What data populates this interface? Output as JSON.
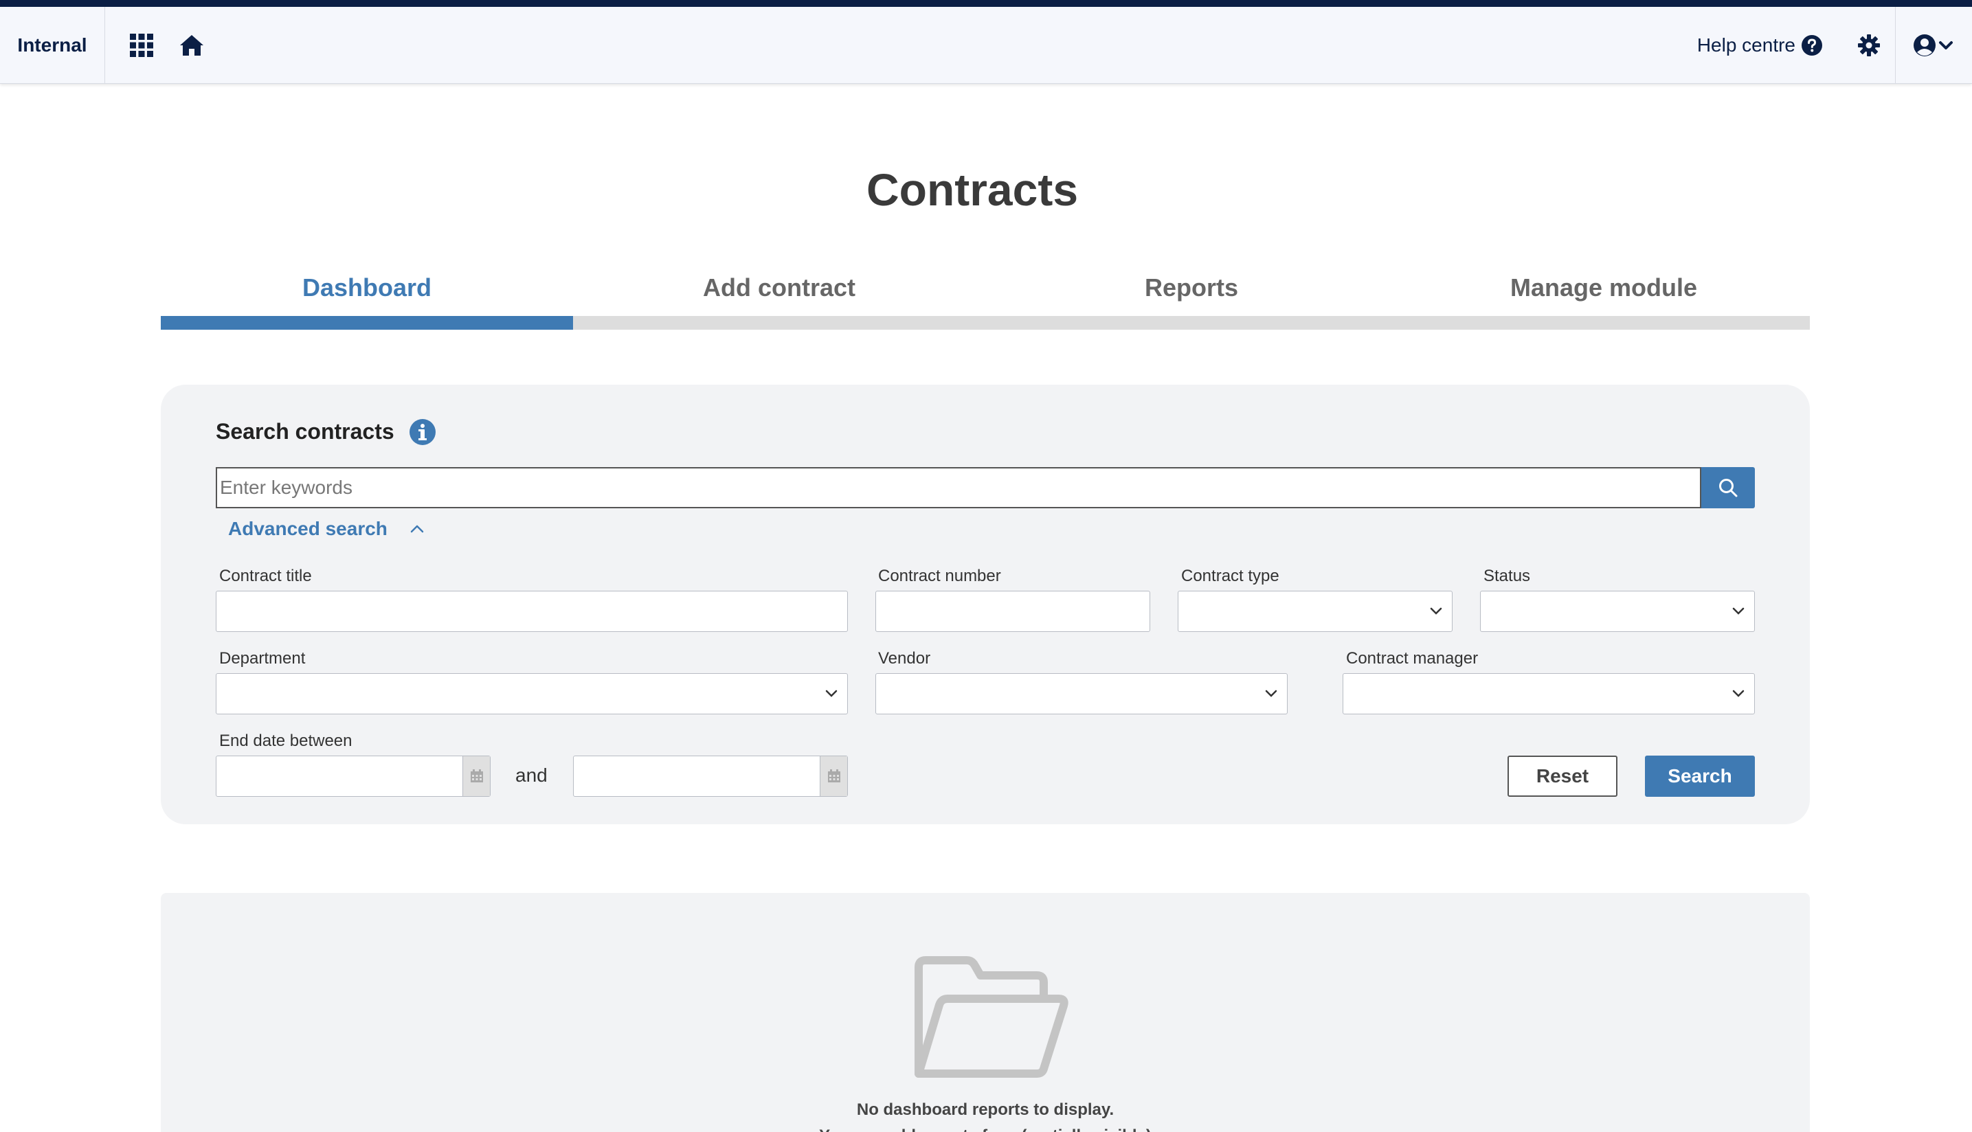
{
  "navbar": {
    "brand": "Internal",
    "help_label": "Help centre",
    "icons": [
      "apps-grid-icon",
      "home-icon",
      "help-circle-icon",
      "gear-icon",
      "user-account-icon",
      "chevron-down-icon"
    ],
    "brand_color": "#0b1f45"
  },
  "page": {
    "title": "Contracts"
  },
  "tabs": [
    {
      "label": "Dashboard",
      "active": true
    },
    {
      "label": "Add contract",
      "active": false
    },
    {
      "label": "Reports",
      "active": false
    },
    {
      "label": "Manage module",
      "active": false
    }
  ],
  "search": {
    "title": "Search contracts",
    "keywords_placeholder": "Enter keywords",
    "keywords_value": "",
    "advanced_label": "Advanced search",
    "fields": {
      "contract_title": {
        "label": "Contract title",
        "value": ""
      },
      "contract_number": {
        "label": "Contract number",
        "value": ""
      },
      "contract_type": {
        "label": "Contract type",
        "value": ""
      },
      "status": {
        "label": "Status",
        "value": ""
      },
      "department": {
        "label": "Department",
        "value": ""
      },
      "vendor": {
        "label": "Vendor",
        "value": ""
      },
      "contract_manager": {
        "label": "Contract manager",
        "value": ""
      },
      "end_date": {
        "label": "End date between",
        "from": "",
        "to": "",
        "and_label": "and"
      }
    },
    "reset_label": "Reset",
    "search_label": "Search",
    "accent_color": "#3f7ab3"
  },
  "dashboard": {
    "empty_message": "No dashboard reports to display.",
    "empty_sub": "You can add reports for... (partially visible)"
  }
}
